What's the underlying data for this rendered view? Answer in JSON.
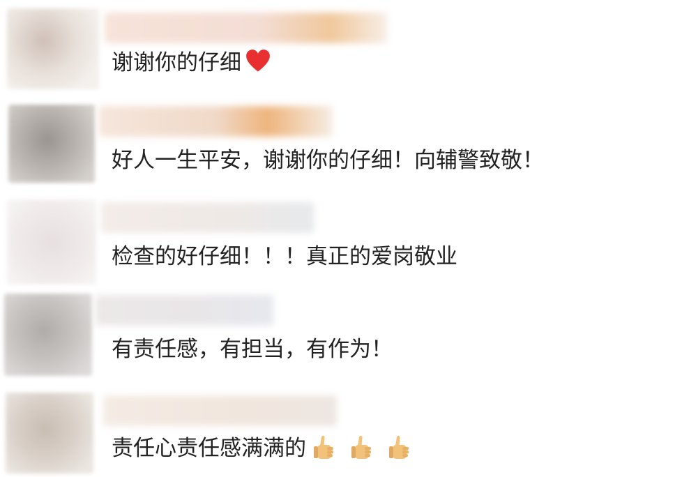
{
  "comments": [
    {
      "text": "谢谢你的仔细",
      "emoji": "heart-icon"
    },
    {
      "text": "好人一生平安，谢谢你的仔细！向辅警致敬！"
    },
    {
      "text": "检查的好仔细！！！真正的爱岗敬业"
    },
    {
      "text": "有责任感，有担当，有作为！"
    },
    {
      "text": "责任心责任感满满的",
      "emoji": "thumbs-up-icon",
      "emoji_count": 3
    }
  ],
  "colors": {
    "text": "#222222",
    "heart": "#e83030",
    "thumb": "#f2c27a"
  }
}
